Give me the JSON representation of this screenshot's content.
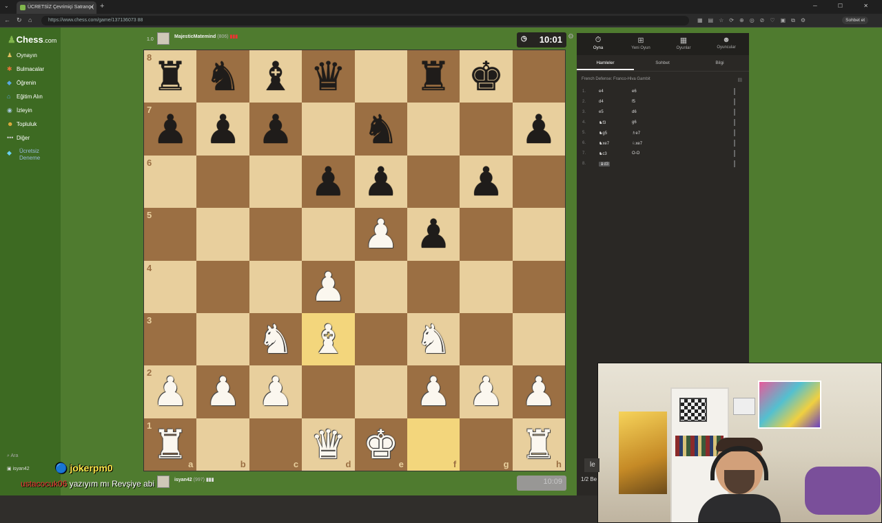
{
  "browser": {
    "tab_title": "ÜCRETSİZ Çevrimiçi Satranç (",
    "url": "https://www.chess.com/game/137136073 88",
    "profile_label": "Sohbet et"
  },
  "sidebar": {
    "logo": "Chess",
    "logo_suffix": ".com",
    "items": [
      {
        "label": "Oynayın",
        "icon": "pawn-icon"
      },
      {
        "label": "Bulmacalar",
        "icon": "puzzle-icon"
      },
      {
        "label": "Öğrenin",
        "icon": "learn-icon"
      },
      {
        "label": "Eğitim Alın",
        "icon": "graduation-icon"
      },
      {
        "label": "İzleyin",
        "icon": "watch-icon"
      },
      {
        "label": "Topluluk",
        "icon": "community-icon"
      },
      {
        "label": "Diğer",
        "icon": "more-icon"
      },
      {
        "label": "Ücretsiz Deneme",
        "icon": "diamond-icon"
      }
    ],
    "search_label": "Ara",
    "user_label": "isyan42"
  },
  "stream_overlay": {
    "joker_label": "jokerpm0",
    "chat_nick": "ustacocuk06",
    "chat_text": "yazıyım mı Revşiye abi"
  },
  "top_player": {
    "rank_tag": "1.0",
    "name": "MajesticMatemind",
    "rating": "(806)",
    "clock": "10:01"
  },
  "bottom_player": {
    "name": "isyan42",
    "rating": "(997)",
    "clock": "10:09"
  },
  "board": {
    "ranks": [
      "8",
      "7",
      "6",
      "5",
      "4",
      "3",
      "2",
      "1"
    ],
    "files": [
      "a",
      "b",
      "c",
      "d",
      "e",
      "f",
      "g",
      "h"
    ],
    "position": [
      [
        "r",
        "n",
        "b",
        "q",
        "",
        "r",
        "k",
        ""
      ],
      [
        "p",
        "p",
        "p",
        "",
        "n",
        "",
        "",
        "p"
      ],
      [
        "",
        "",
        "",
        "p",
        "p",
        "",
        "p",
        ""
      ],
      [
        "",
        "",
        "",
        "",
        "P",
        "p",
        "",
        ""
      ],
      [
        "",
        "",
        "",
        "P",
        "",
        "",
        "",
        ""
      ],
      [
        "",
        "",
        "N",
        "B",
        "",
        "N",
        "",
        ""
      ],
      [
        "P",
        "P",
        "P",
        "",
        "",
        "P",
        "P",
        "P"
      ],
      [
        "R",
        "",
        "",
        "Q",
        "K",
        "",
        "",
        "R"
      ]
    ],
    "highlighted_squares": [
      "d3",
      "f1"
    ]
  },
  "panel": {
    "tabs": [
      {
        "label": "Oyna",
        "icon": "stopwatch-icon"
      },
      {
        "label": "Yeni Oyun",
        "icon": "plus-icon"
      },
      {
        "label": "Oyunlar",
        "icon": "grid-icon"
      },
      {
        "label": "Oyuncular",
        "icon": "players-icon"
      }
    ],
    "subtabs": [
      "Hamleler",
      "Sohbet",
      "Bilgi"
    ],
    "opening": "French Defense: Franco-Hiva Gambit",
    "moves": [
      {
        "num": "1.",
        "white": "e4",
        "black": "e6"
      },
      {
        "num": "2.",
        "white": "d4",
        "black": "f5"
      },
      {
        "num": "3.",
        "white": "e5",
        "black": "d6"
      },
      {
        "num": "4.",
        "white": "♞f3",
        "black": "g6"
      },
      {
        "num": "5.",
        "white": "♞g5",
        "black": "♗e7"
      },
      {
        "num": "6.",
        "white": "♞xe7",
        "black": "♘xe7"
      },
      {
        "num": "7.",
        "white": "♞c3",
        "black": "O-O"
      },
      {
        "num": "8.",
        "white": "♝d3",
        "black": ""
      }
    ]
  },
  "footer": {
    "half_label": "1/2",
    "ie_label": "le"
  }
}
